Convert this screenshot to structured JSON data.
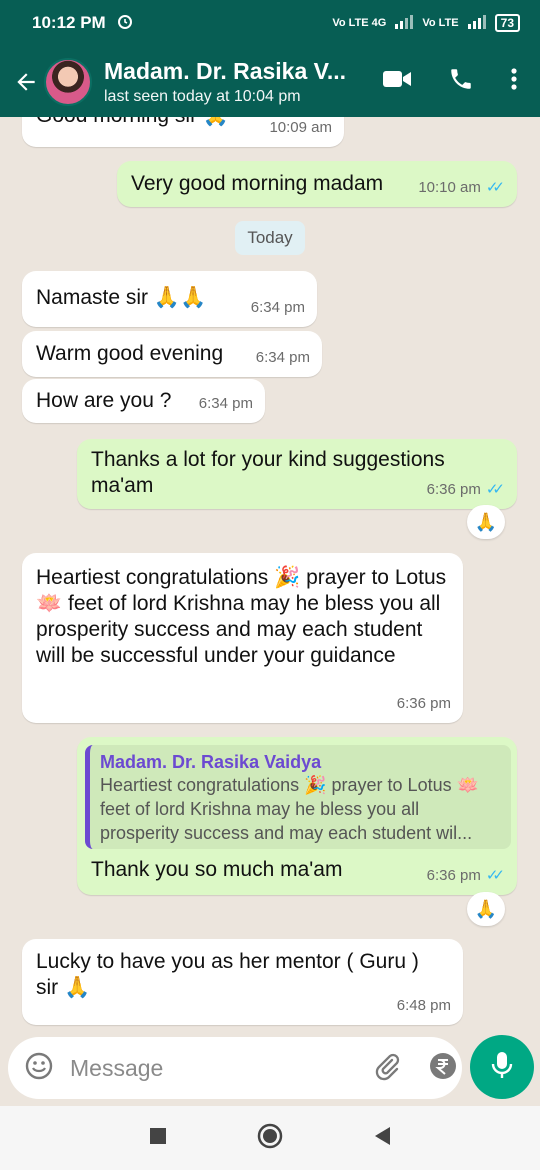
{
  "status": {
    "time": "10:12 PM",
    "network1": "Vo LTE 4G",
    "network2": "Vo LTE",
    "battery": "73"
  },
  "header": {
    "contact_name": "Madam. Dr. Rasika V...",
    "last_seen": "last seen today at 10:04 pm"
  },
  "messages": [
    {
      "text": "Good morning sir 🙏",
      "time": "10:09 am"
    },
    {
      "text": "Very good morning madam",
      "time": "10:10 am"
    },
    {
      "text": "Namaste sir 🙏🙏",
      "time": "6:34 pm"
    },
    {
      "text": "Warm good evening",
      "time": "6:34 pm"
    },
    {
      "text": "How are you ?",
      "time": "6:34 pm"
    },
    {
      "text": "Thanks a lot for your kind  suggestions ma'am",
      "time": "6:36 pm",
      "reaction": "🙏"
    },
    {
      "text": "Heartiest congratulations 🎉 prayer to Lotus 🪷 feet of lord Krishna may he bless you all prosperity success and may each student will be successful under your guidance",
      "time": "6:36 pm"
    },
    {
      "text": "Thank you so much ma'am",
      "time": "6:36 pm",
      "reaction": "🙏",
      "quote_author": "Madam. Dr. Rasika Vaidya",
      "quote_text": "Heartiest congratulations 🎉 prayer to Lotus 🪷 feet of lord Krishna may he bless you all prosperity success and may each student wil..."
    },
    {
      "text": "Lucky to have you as her mentor ( Guru ) sir 🙏",
      "time": "6:48 pm"
    }
  ],
  "date_chip": "Today",
  "input": {
    "placeholder": "Message"
  },
  "icons": {
    "back": "arrow-back-icon",
    "video": "video-call-icon",
    "call": "phone-icon",
    "menu": "more-vert-icon",
    "emoji": "emoji-icon",
    "attach": "attach-icon",
    "rupee": "rupee-icon",
    "camera": "camera-icon",
    "mic": "mic-icon"
  },
  "colors": {
    "header": "#075e54",
    "outgoing": "#dcf8c6",
    "incoming": "#ffffff",
    "accent": "#00a884",
    "quote_author": "#6c4ad1"
  }
}
